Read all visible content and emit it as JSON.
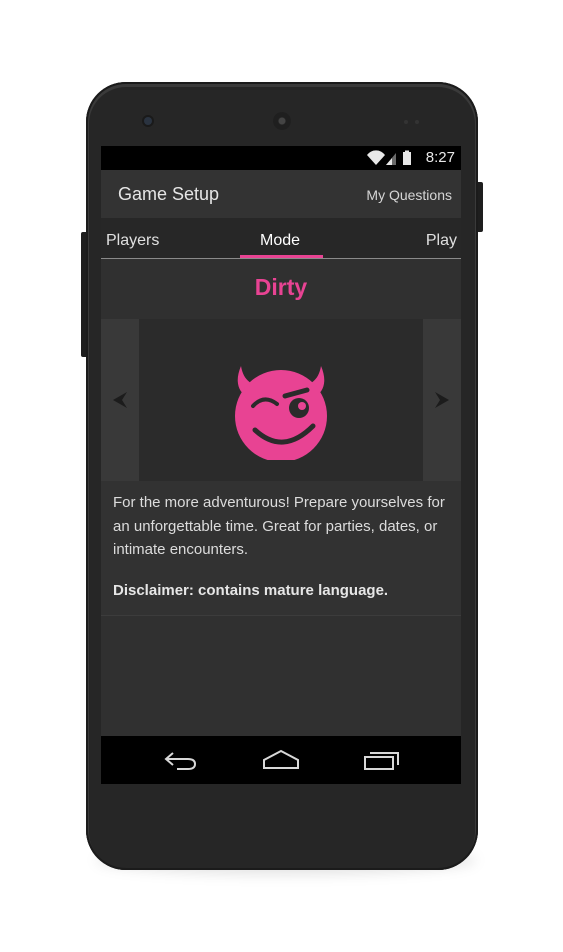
{
  "status_bar": {
    "time": "8:27",
    "icons": [
      "wifi-icon",
      "signal-icon",
      "battery-icon"
    ]
  },
  "action_bar": {
    "title": "Game Setup",
    "my_questions_label": "My Questions"
  },
  "tabs": [
    {
      "label": "Players",
      "selected": false
    },
    {
      "label": "Mode",
      "selected": true
    },
    {
      "label": "Play",
      "selected": false
    }
  ],
  "mode": {
    "name": "Dirty",
    "icon": "winking-devil-icon",
    "description": "For the more adventurous! Prepare yourselves for an unforgettable time. Great for parties, dates, or intimate encounters.",
    "disclaimer": "Disclaimer: contains mature language."
  },
  "colors": {
    "accent": "#e84393",
    "background": "#303030",
    "action_bar": "#333333"
  },
  "nav_bar": {
    "icons": [
      "back-icon",
      "home-icon",
      "recents-icon"
    ]
  }
}
